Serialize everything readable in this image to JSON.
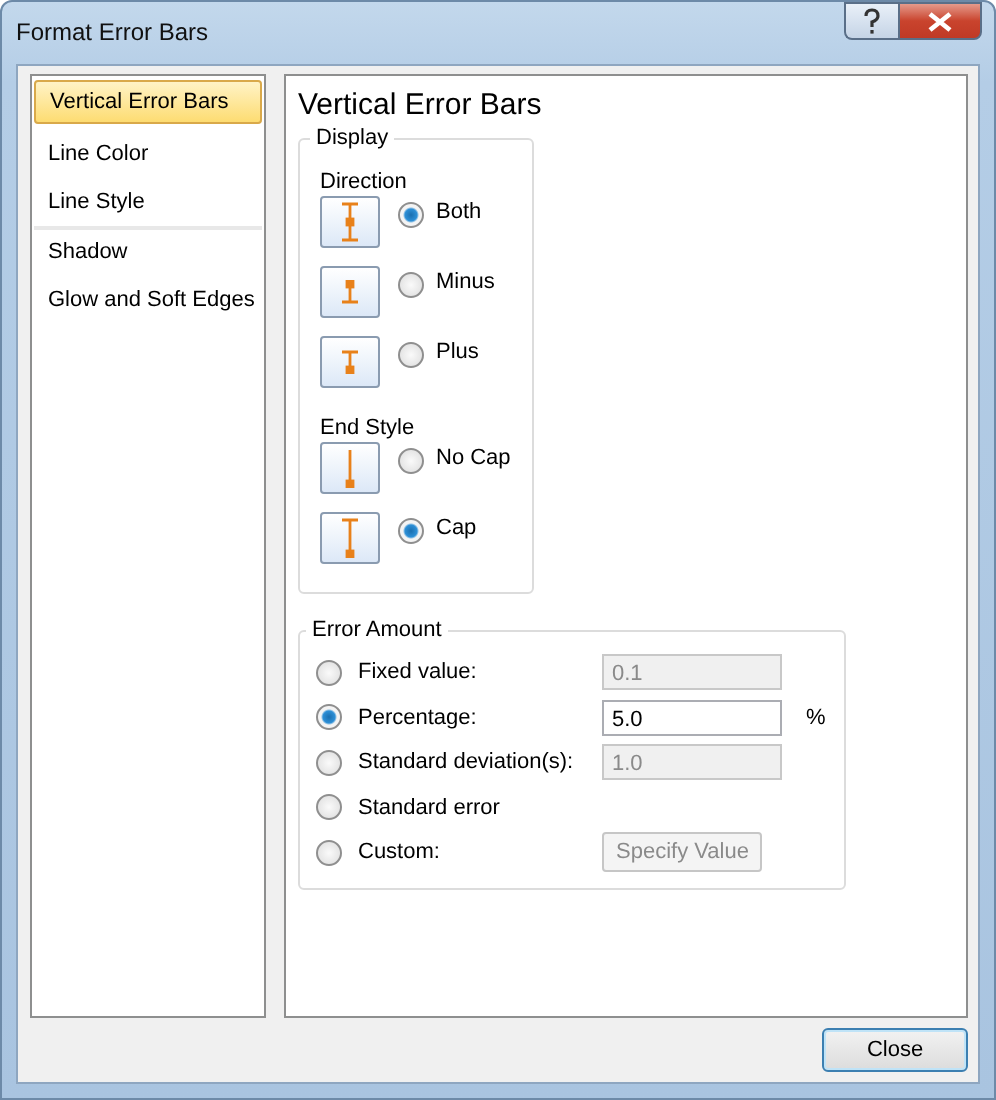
{
  "window": {
    "title": "Format Error Bars"
  },
  "sidebar": {
    "items": [
      {
        "label": "Vertical Error Bars",
        "selected": true,
        "separator_before": false
      },
      {
        "label": "Line Color",
        "selected": false,
        "separator_before": false
      },
      {
        "label": "Line Style",
        "selected": false,
        "separator_before": false
      },
      {
        "label": "Shadow",
        "selected": false,
        "separator_before": true
      },
      {
        "label": "Glow and Soft Edges",
        "selected": false,
        "separator_before": false
      }
    ]
  },
  "panel": {
    "title": "Vertical Error Bars",
    "display": {
      "title": "Display",
      "direction": {
        "label": "Direction",
        "options": [
          {
            "label": "Both",
            "kind": "both",
            "selected": true
          },
          {
            "label": "Minus",
            "kind": "minus",
            "selected": false
          },
          {
            "label": "Plus",
            "kind": "plus",
            "selected": false
          }
        ]
      },
      "end_style": {
        "label": "End Style",
        "options": [
          {
            "label": "No Cap",
            "kind": "nocap",
            "selected": false
          },
          {
            "label": "Cap",
            "kind": "cap",
            "selected": true
          }
        ]
      }
    },
    "error_amount": {
      "title": "Error Amount",
      "options": [
        {
          "label": "Fixed value:",
          "selected": false,
          "kind": "field",
          "value": "0.1",
          "disabled": true
        },
        {
          "label": "Percentage:",
          "selected": true,
          "kind": "field",
          "value": "5.0",
          "disabled": false,
          "unit": "%"
        },
        {
          "label": "Standard deviation(s):",
          "selected": false,
          "kind": "field",
          "value": "1.0",
          "disabled": true
        },
        {
          "label": "Standard error",
          "selected": false,
          "kind": "plain"
        },
        {
          "label": "Custom:",
          "selected": false,
          "kind": "button",
          "button": "Specify Value",
          "disabled": true
        }
      ]
    }
  },
  "buttons": [
    {
      "label": "Close"
    }
  ]
}
